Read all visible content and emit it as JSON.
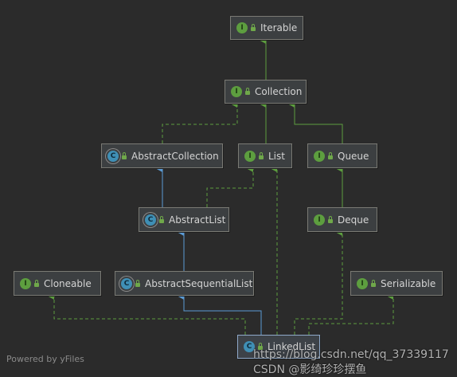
{
  "nodes": {
    "iterable": {
      "label": "Iterable",
      "kind": "interface"
    },
    "collection": {
      "label": "Collection",
      "kind": "interface"
    },
    "abstract_collection": {
      "label": "AbstractCollection",
      "kind": "abstract-class"
    },
    "list": {
      "label": "List",
      "kind": "interface"
    },
    "queue": {
      "label": "Queue",
      "kind": "interface"
    },
    "abstract_list": {
      "label": "AbstractList",
      "kind": "abstract-class"
    },
    "deque": {
      "label": "Deque",
      "kind": "interface"
    },
    "cloneable": {
      "label": "Cloneable",
      "kind": "interface"
    },
    "abstract_sequential_list": {
      "label": "AbstractSequentialList",
      "kind": "abstract-class"
    },
    "serializable": {
      "label": "Serializable",
      "kind": "interface"
    },
    "linked_list": {
      "label": "LinkedList",
      "kind": "class"
    }
  },
  "badges": {
    "interface": "I",
    "class": "C"
  },
  "footer": "Powered by yFiles",
  "watermark": "https://blog.csdn.net/qq_37339117 CSDN @影绮珍珍摆鱼",
  "colors": {
    "implements": "#5d9e3f",
    "extends": "#5b9bd5",
    "background": "#2b2b2b"
  }
}
